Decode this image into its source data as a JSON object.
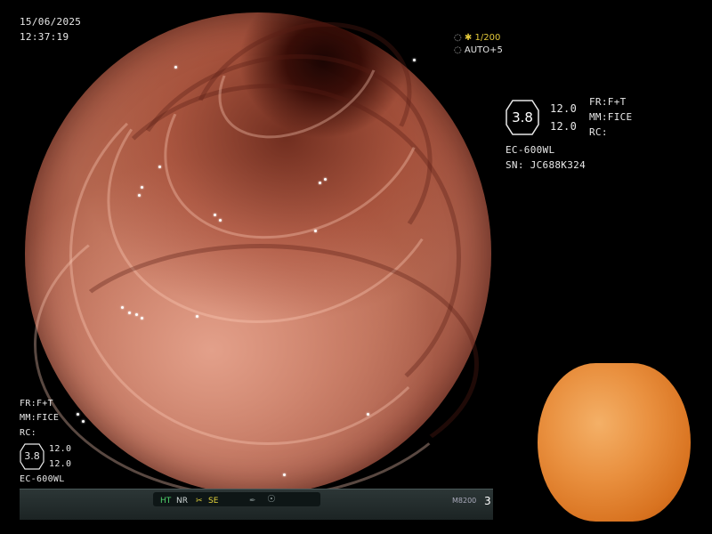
{
  "header": {
    "date": "15/06/2025",
    "time": "12:37:19"
  },
  "shutter": {
    "value": "1/200",
    "auto": "AUTO+5"
  },
  "right_panel": {
    "badge_value": "3.8",
    "value_1": "12.0",
    "value_2": "12.0",
    "fr": "FR:F+T",
    "mm": "MM:FICE",
    "rc": "RC:",
    "scope_model": "EC-600WL",
    "serial": "SN: JC688K324"
  },
  "left_panel": {
    "fr": "FR:F+T",
    "mm": "MM:FICE",
    "rc": "RC:",
    "badge_value": "3.8",
    "value_1": "12.0",
    "value_2": "12.0",
    "scope_model": "EC-600WL"
  },
  "status_bar": {
    "ht": "HT",
    "nr": "NR",
    "se": "SE",
    "model": "M8200",
    "page": "3"
  },
  "colors": {
    "ht": "#4ed06a",
    "se": "#e3d23a",
    "shutter": "#e3c83a"
  },
  "icons": [
    "camera-icon",
    "star-icon",
    "se-scissor-icon",
    "pen-icon",
    "gauge-icon"
  ]
}
